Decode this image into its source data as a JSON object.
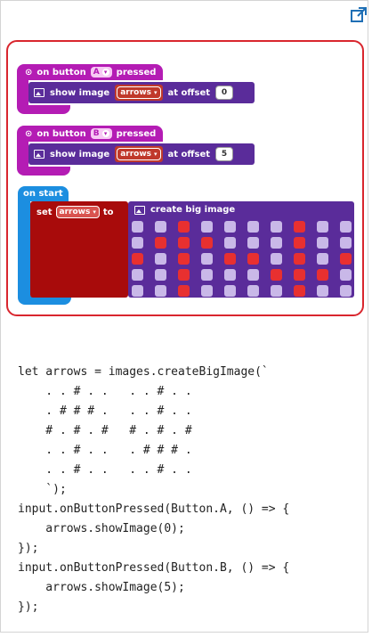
{
  "blocks": {
    "event_a": {
      "prefix": "on button",
      "button": "A",
      "suffix": "pressed"
    },
    "stmt_a": {
      "label": "show image",
      "var": "arrows",
      "offset_label": "at offset",
      "offset": "0"
    },
    "event_b": {
      "prefix": "on button",
      "button": "B",
      "suffix": "pressed"
    },
    "stmt_b": {
      "label": "show image",
      "var": "arrows",
      "offset_label": "at offset",
      "offset": "5"
    },
    "on_start": "on start",
    "set": {
      "label": "set",
      "var": "arrows",
      "to": "to"
    },
    "big_image": {
      "label": "create big image"
    },
    "led_rows": [
      [
        0,
        0,
        1,
        0,
        0,
        0,
        0,
        1,
        0,
        0
      ],
      [
        0,
        1,
        1,
        1,
        0,
        0,
        0,
        1,
        0,
        0
      ],
      [
        1,
        0,
        1,
        0,
        1,
        1,
        0,
        1,
        0,
        1
      ],
      [
        0,
        0,
        1,
        0,
        0,
        0,
        1,
        1,
        1,
        0
      ],
      [
        0,
        0,
        1,
        0,
        0,
        0,
        0,
        1,
        0,
        0
      ]
    ]
  },
  "code_lines": [
    "let arrows = images.createBigImage(`",
    "    . . # . .   . . # . .",
    "    . # # # .   . . # . .",
    "    # . # . #   # . # . #",
    "    . . # . .   . # # # .",
    "    . . # . .   . . # . .",
    "    `);",
    "input.onButtonPressed(Button.A, () => {",
    "    arrows.showImage(0);",
    "});",
    "input.onButtonPressed(Button.B, () => {",
    "    arrows.showImage(5);",
    "});"
  ],
  "colors": {
    "event": "#b41cb4",
    "image": "#5a2c9a",
    "variable": "#a80b0b",
    "basic": "#1c8ee0",
    "led_on": "#e83030",
    "led_off": "#c9b8e8",
    "highlight": "#d9262e"
  },
  "icons": {
    "open_external": "open-external-icon"
  }
}
